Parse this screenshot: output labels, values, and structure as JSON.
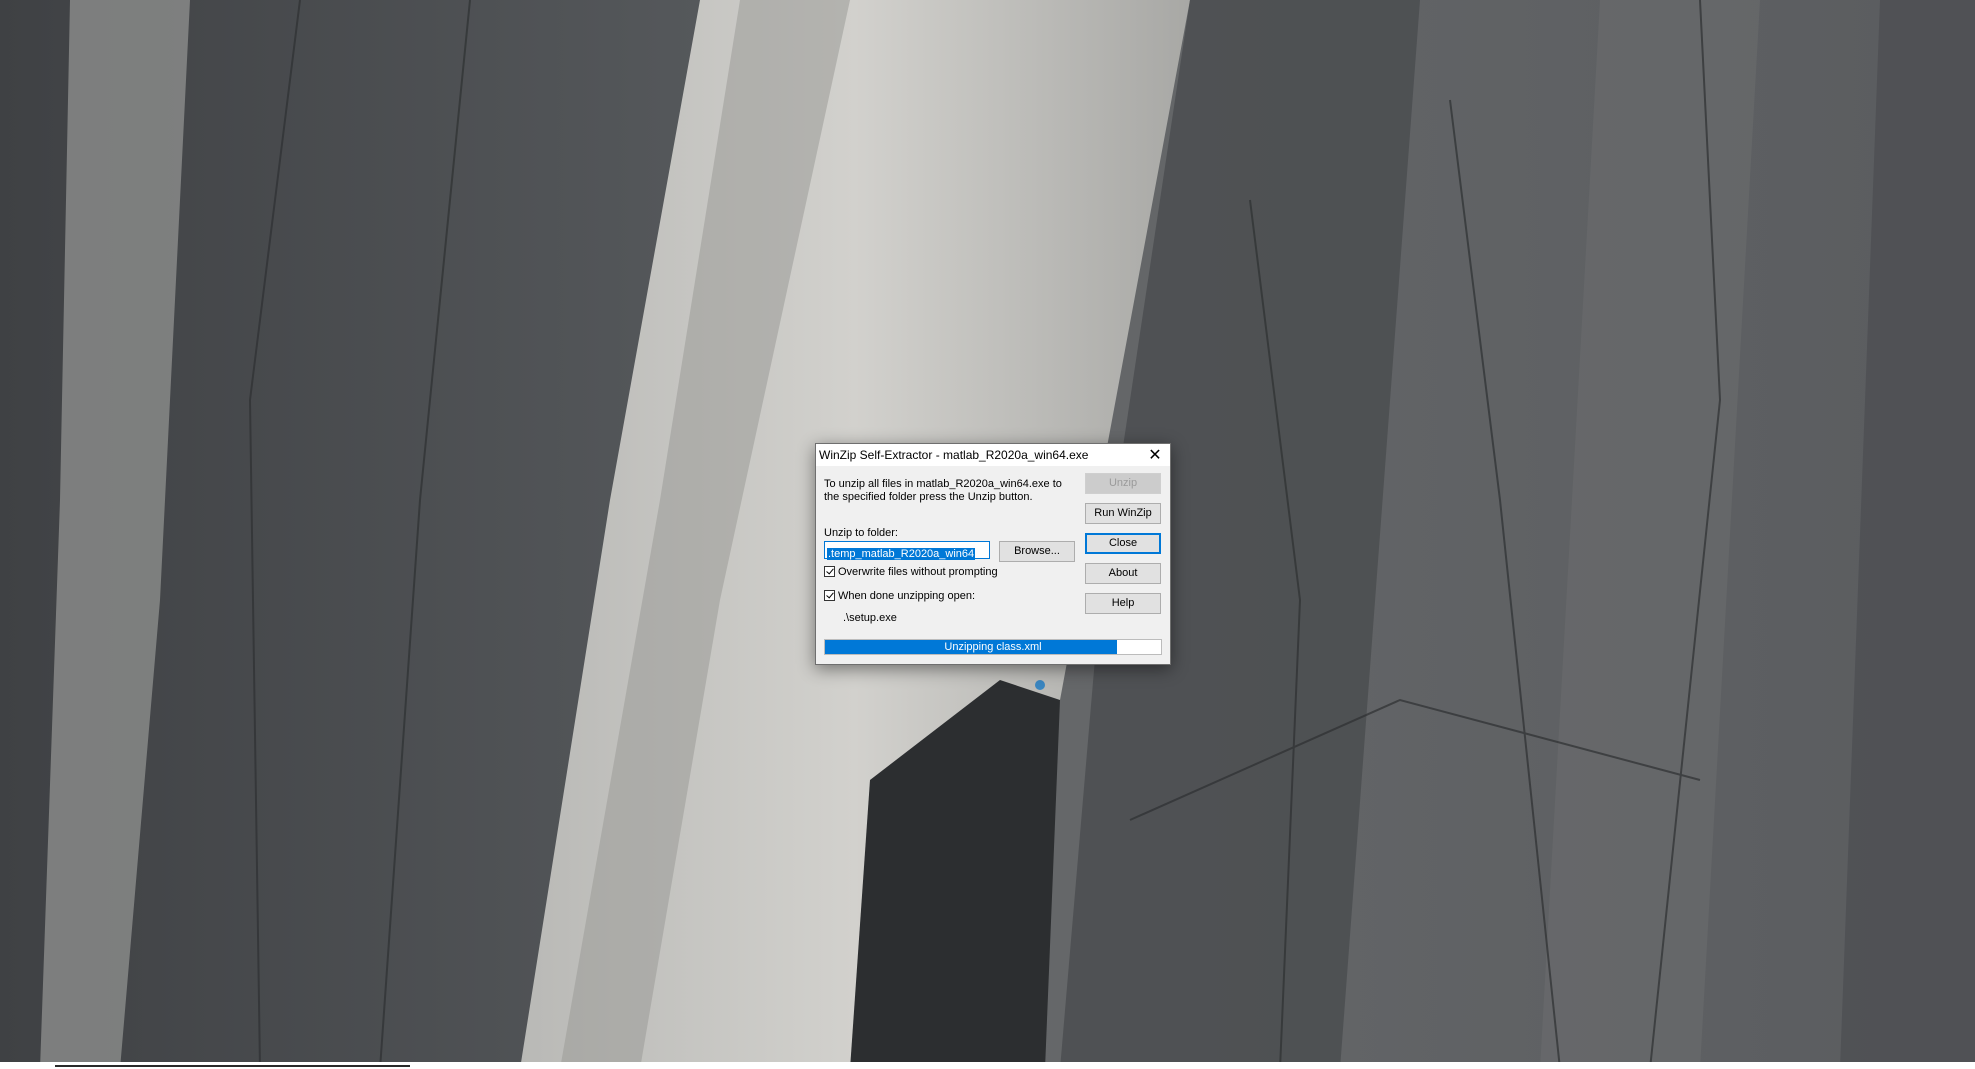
{
  "dialog": {
    "title": "WinZip Self-Extractor - matlab_R2020a_win64.exe",
    "description": "To unzip all files in matlab_R2020a_win64.exe to the specified folder press the Unzip button.",
    "folder_label": "Unzip to folder:",
    "folder_value": ".temp_matlab_R2020a_win64",
    "browse_label": "Browse...",
    "overwrite_label": "Overwrite files without prompting",
    "overwrite_checked": true,
    "when_done_label": "When done unzipping open:",
    "when_done_checked": true,
    "open_target": ".\\setup.exe",
    "buttons": {
      "unzip": "Unzip",
      "run_winzip": "Run WinZip",
      "close": "Close",
      "about": "About",
      "help": "Help"
    },
    "progress": {
      "text": "Unzipping class.xml",
      "fraction": 0.87
    }
  },
  "colors": {
    "accent": "#0078d7",
    "dialog_bg": "#f0f0f0"
  }
}
